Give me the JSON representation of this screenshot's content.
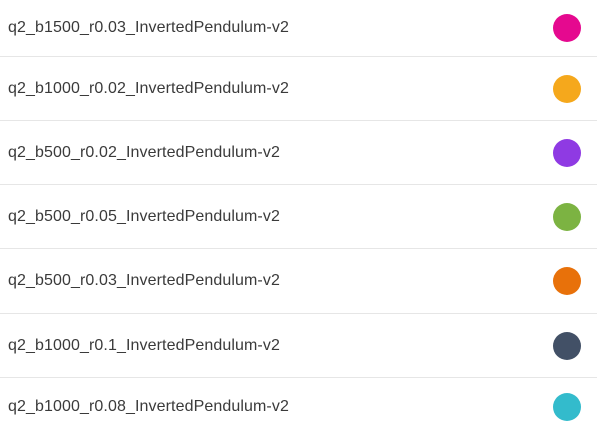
{
  "runs": [
    {
      "label": "q2_b1500_r0.03_InvertedPendulum-v2",
      "color": "#e5098f"
    },
    {
      "label": "q2_b1000_r0.02_InvertedPendulum-v2",
      "color": "#f5a81c"
    },
    {
      "label": "q2_b500_r0.02_InvertedPendulum-v2",
      "color": "#8f3ae3"
    },
    {
      "label": "q2_b500_r0.05_InvertedPendulum-v2",
      "color": "#7cb342"
    },
    {
      "label": "q2_b500_r0.03_InvertedPendulum-v2",
      "color": "#e8710a"
    },
    {
      "label": "q2_b1000_r0.1_InvertedPendulum-v2",
      "color": "#425066"
    },
    {
      "label": "q2_b1000_r0.08_InvertedPendulum-v2",
      "color": "#33bbcc"
    }
  ]
}
